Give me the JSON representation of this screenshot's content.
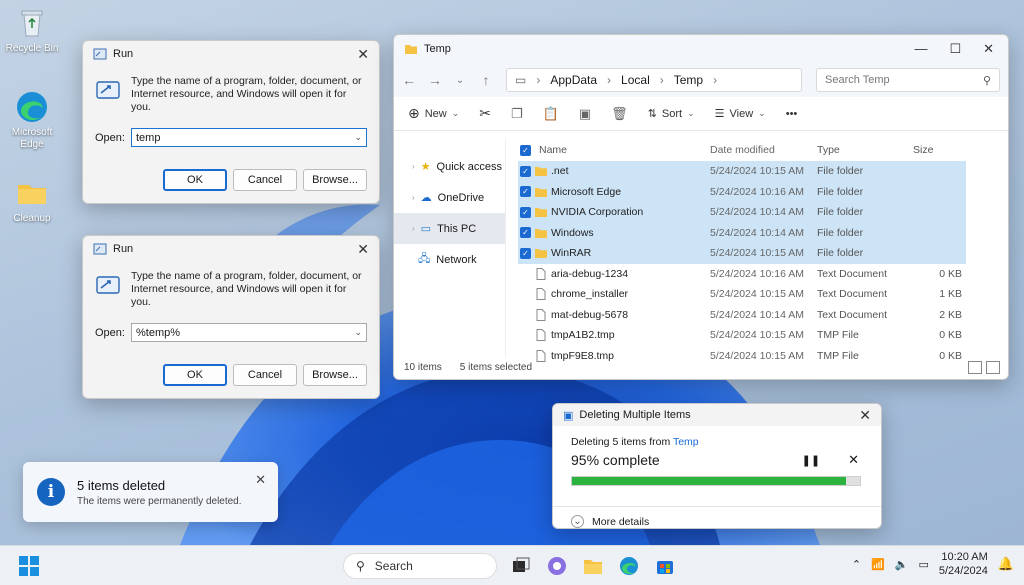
{
  "desktop": {
    "icons": [
      {
        "label": "Recycle Bin"
      },
      {
        "label": "Microsoft Edge"
      },
      {
        "label": "Cleanup"
      }
    ]
  },
  "run1": {
    "title": "Run",
    "prompt": "Type the name of a program, folder, document, or Internet resource, and Windows will open it for you.",
    "open_label": "Open:",
    "value": "temp",
    "ok": "OK",
    "cancel": "Cancel",
    "browse": "Browse..."
  },
  "run2": {
    "title": "Run",
    "prompt": "Type the name of a program, folder, document, or Internet resource, and Windows will open it for you.",
    "open_label": "Open:",
    "value": "%temp%",
    "ok": "OK",
    "cancel": "Cancel",
    "browse": "Browse..."
  },
  "explorer": {
    "title": "Temp",
    "breadcrumb": [
      "AppData",
      "Local",
      "Temp"
    ],
    "search_placeholder": "Search Temp",
    "toolbar": {
      "new": "New",
      "sort": "Sort",
      "view": "View",
      "more": "•••"
    },
    "nav": [
      {
        "label": "Quick access"
      },
      {
        "label": "OneDrive"
      },
      {
        "label": "This PC"
      },
      {
        "label": "Network"
      }
    ],
    "columns": {
      "name": "Name",
      "date": "Date modified",
      "type": "Type",
      "size": "Size"
    },
    "rows": [
      {
        "name": ".net",
        "date": "5/24/2024 10:15 AM",
        "type": "File folder",
        "size": "",
        "selected": true,
        "kind": "folder"
      },
      {
        "name": "Microsoft Edge",
        "date": "5/24/2024 10:16 AM",
        "type": "File folder",
        "size": "",
        "selected": true,
        "kind": "folder"
      },
      {
        "name": "NVIDIA Corporation",
        "date": "5/24/2024 10:14 AM",
        "type": "File folder",
        "size": "",
        "selected": true,
        "kind": "folder"
      },
      {
        "name": "Windows",
        "date": "5/24/2024 10:14 AM",
        "type": "File folder",
        "size": "",
        "selected": true,
        "kind": "folder"
      },
      {
        "name": "WinRAR",
        "date": "5/24/2024 10:15 AM",
        "type": "File folder",
        "size": "",
        "selected": true,
        "kind": "folder"
      },
      {
        "name": "aria-debug-1234",
        "date": "5/24/2024 10:16 AM",
        "type": "Text Document",
        "size": "0 KB",
        "selected": false,
        "kind": "file"
      },
      {
        "name": "chrome_installer",
        "date": "5/24/2024 10:15 AM",
        "type": "Text Document",
        "size": "1 KB",
        "selected": false,
        "kind": "file"
      },
      {
        "name": "mat-debug-5678",
        "date": "5/24/2024 10:14 AM",
        "type": "Text Document",
        "size": "2 KB",
        "selected": false,
        "kind": "file"
      },
      {
        "name": "tmpA1B2.tmp",
        "date": "5/24/2024 10:15 AM",
        "type": "TMP File",
        "size": "0 KB",
        "selected": false,
        "kind": "file"
      },
      {
        "name": "tmpF9E8.tmp",
        "date": "5/24/2024 10:15 AM",
        "type": "TMP File",
        "size": "0 KB",
        "selected": false,
        "kind": "file"
      }
    ],
    "status_items": "10 items",
    "status_selected": "5 items selected"
  },
  "progress": {
    "title": "Deleting Multiple Items",
    "line1_prefix": "Deleting 5 items from ",
    "line1_folder": "Temp",
    "percent_text": "95% complete",
    "percent": 95,
    "more_details": "More details"
  },
  "toast": {
    "title": "5 items deleted",
    "body": "The items were permanently deleted."
  },
  "taskbar": {
    "search": "Search",
    "time": "10:20 AM",
    "date": "5/24/2024"
  },
  "colors": {
    "accent": "#1b6ad1",
    "progress": "#2cb33f",
    "selection": "#cde4f7"
  }
}
